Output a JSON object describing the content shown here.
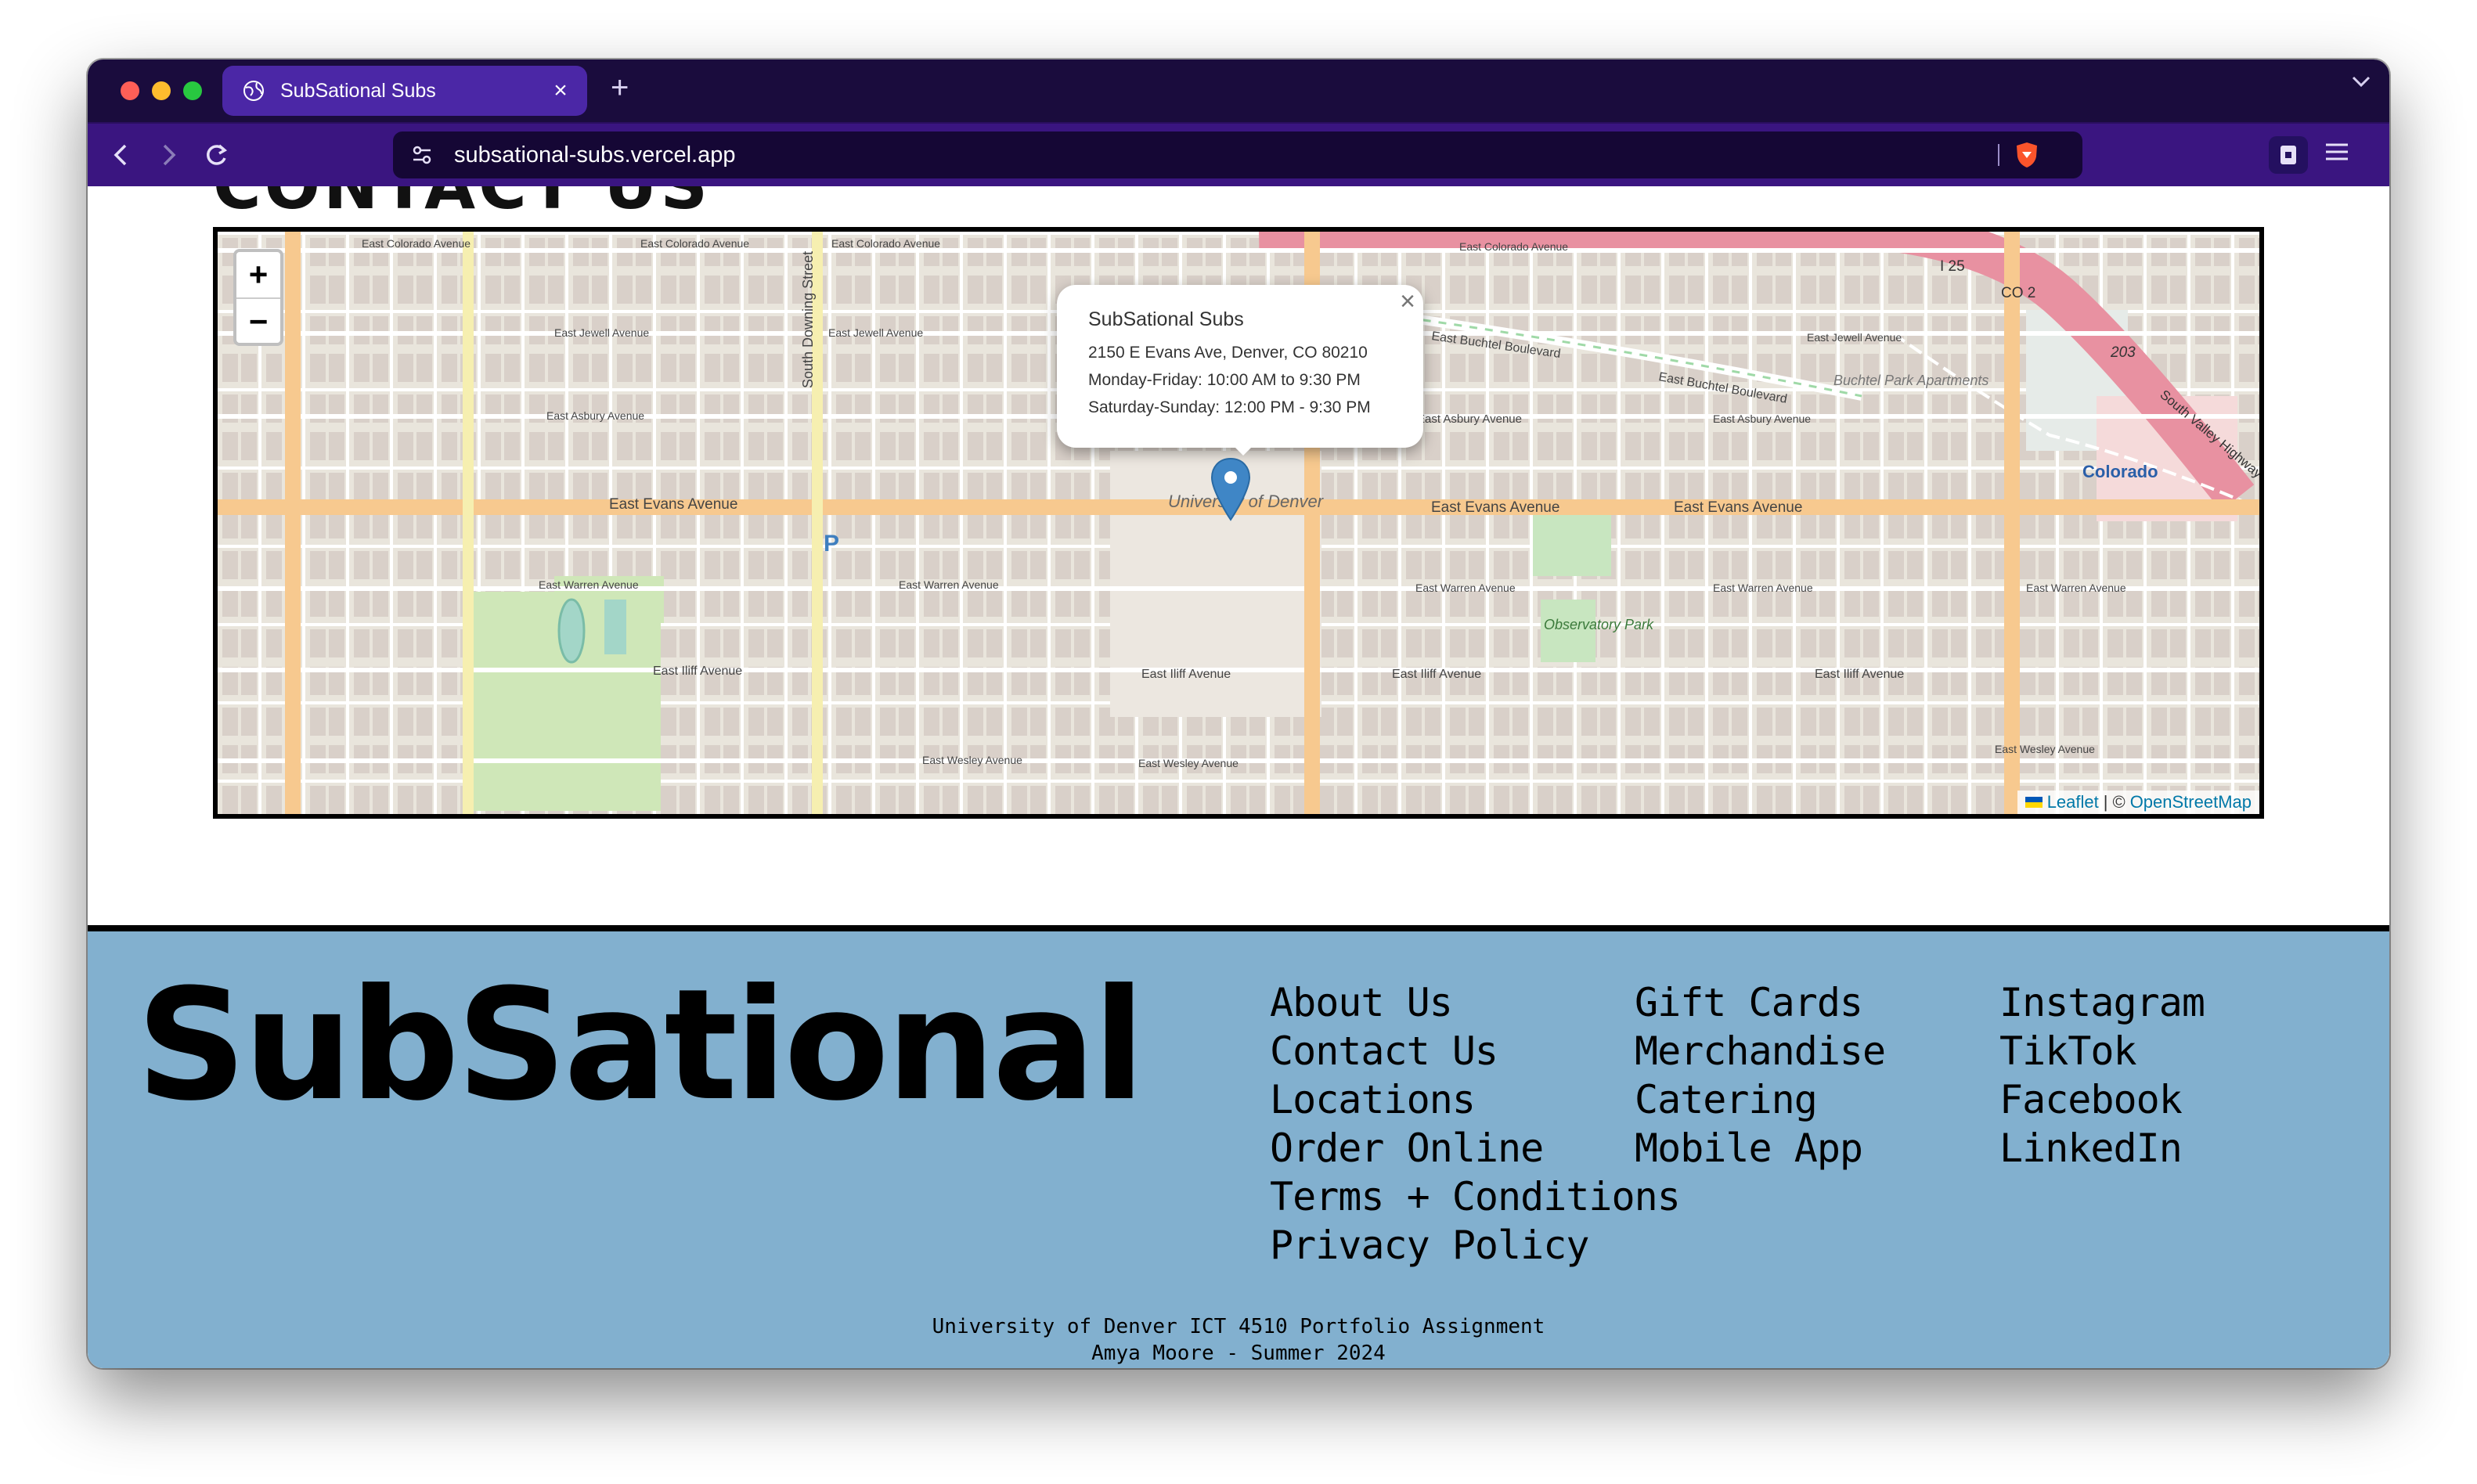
{
  "browser": {
    "tab_title": "SubSational Subs",
    "url": "subsational-subs.vercel.app",
    "new_tab_label": "+",
    "close_tab_label": "×",
    "icons": [
      "globe-icon",
      "close-icon",
      "plus-icon",
      "chevron-down-icon",
      "back-icon",
      "forward-icon",
      "reload-icon",
      "site-info-icon",
      "brave-shield-icon",
      "wallet-icon",
      "menu-icon"
    ]
  },
  "page": {
    "section_heading": "CONTACT US"
  },
  "map": {
    "zoom_in": "+",
    "zoom_out": "−",
    "popup": {
      "title": "SubSational Subs",
      "address": "2150 E Evans Ave, Denver, CO 80210",
      "hours_weekday": "Monday-Friday: 10:00 AM to 9:30 PM",
      "hours_weekend": "Saturday-Sunday: 12:00 PM - 9:30 PM",
      "close": "×"
    },
    "attribution": {
      "leaflet": "Leaflet",
      "separator": "|",
      "copyright": "©",
      "osm": "OpenStreetMap"
    },
    "labels": {
      "evans_w": "East Evans Avenue",
      "evans_e1": "East Evans Avenue",
      "evans_e2": "East Evans Avenue",
      "colorado_n1": "East Colorado Avenue",
      "colorado_n2": "East Colorado Avenue",
      "colorado_n3": "East Colorado Avenue",
      "colorado_n4": "East Colorado Avenue",
      "jewell1": "East Jewell Avenue",
      "jewell2": "East Jewell Avenue",
      "jewell3": "East Jewell Avenue",
      "asbury1": "East Asbury Avenue",
      "asbury2": "East Asbury Avenue",
      "asbury3": "East Asbury Avenue",
      "buchtel1": "East Buchtel Boulevard",
      "buchtel2": "East Buchtel Boulevard",
      "warren1": "East Warren Avenue",
      "warren2": "East Warren Avenue",
      "warren3": "East Warren Avenue",
      "warren4": "East Warren Avenue",
      "warren5": "East Warren Avenue",
      "iliff1": "East Iliff Avenue",
      "iliff2": "East Iliff Avenue",
      "iliff3": "East Iliff Avenue",
      "iliff4": "East Iliff Avenue",
      "wesley1": "East Wesley Avenue",
      "wesley2": "East Wesley Avenue",
      "wesley3": "East Wesley Avenue",
      "univ": "University of Denver",
      "observatory": "Observatory Park",
      "buchtel_apts": "Buchtel Park Apartments",
      "colorado_station": "Colorado",
      "i25": "I 25",
      "co2": "CO 2",
      "hwy203": "203",
      "valley_hwy": "South Valley Highway",
      "downing": "South Downing Street",
      "parking": "P"
    }
  },
  "footer": {
    "brand": "SubSational",
    "links_col1": [
      "About Us",
      "Contact Us",
      "Locations",
      "Order Online",
      "Terms + Conditions",
      "Privacy Policy"
    ],
    "links_col2": [
      "Gift Cards",
      "Merchandise",
      "Catering",
      "Mobile App"
    ],
    "links_col3": [
      "Instagram",
      "TikTok",
      "Facebook",
      "LinkedIn"
    ],
    "credit_line1": "University of Denver ICT 4510 Portfolio Assignment",
    "credit_line2": "Amya Moore - Summer 2024"
  },
  "colors": {
    "tabbar": "#1a0c3d",
    "toolbar": "#3a1580",
    "active_tab": "#4b27a6",
    "footer_bg": "#82b0cf",
    "map_major_road": "#f7c98f",
    "map_link": "#0078a8"
  }
}
